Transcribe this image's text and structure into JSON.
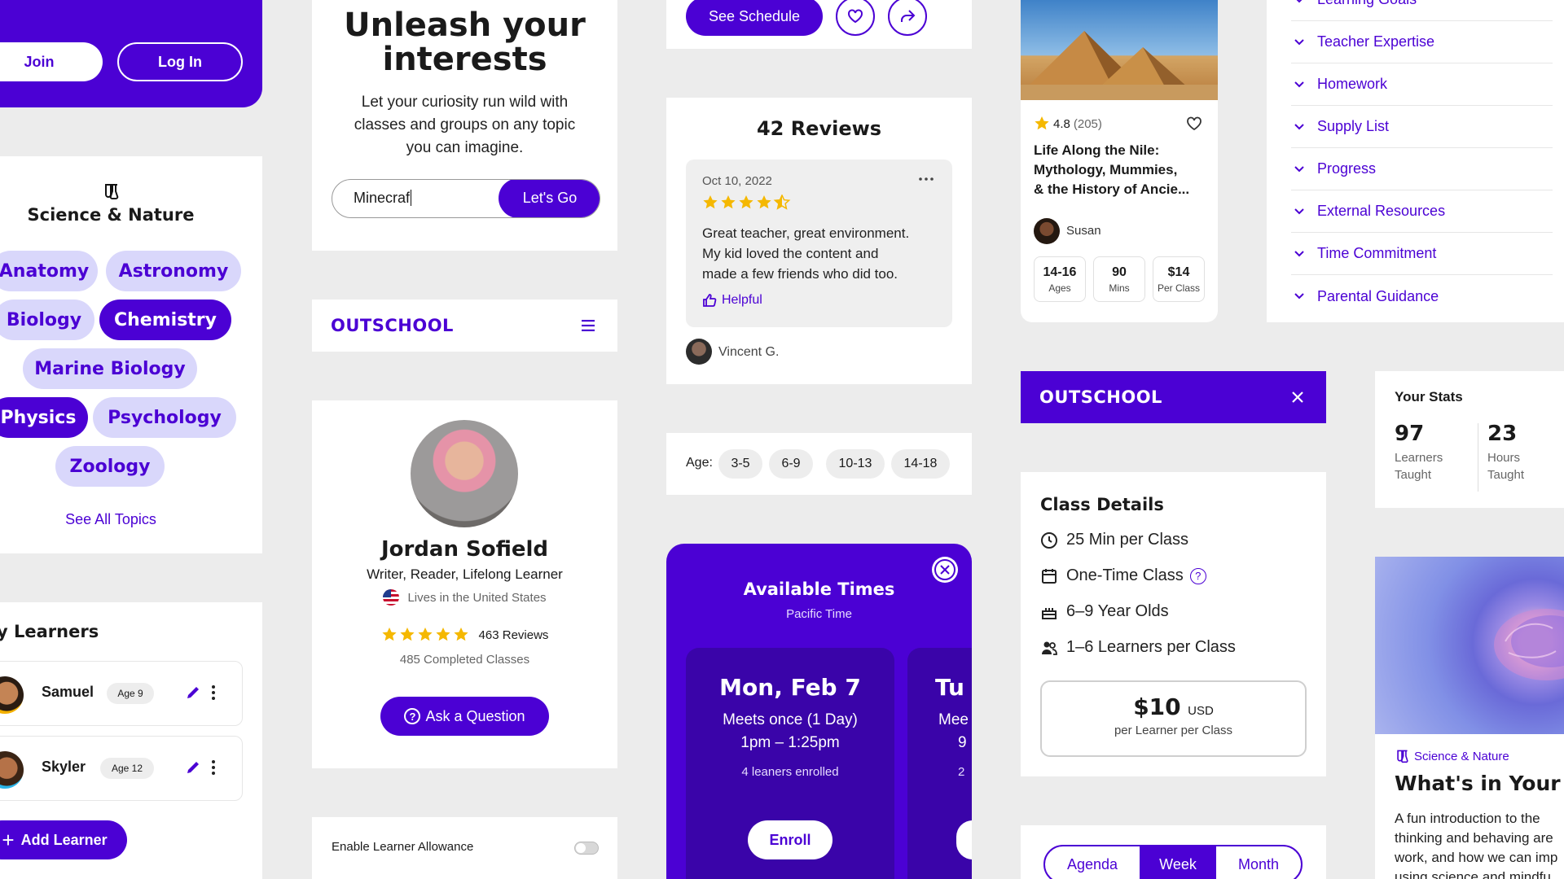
{
  "auth": {
    "join_label": "Join",
    "login_label": "Log In"
  },
  "hero": {
    "title_line1": "Unleash your",
    "title_line2": "interests",
    "subtitle_line1": "Let your curiosity run wild with",
    "subtitle_line2": "classes and groups on any topic",
    "subtitle_line3": "you can imagine.",
    "search_value": "Minecraf",
    "go_label": "Let's Go"
  },
  "topics": {
    "icon": "flask-icon",
    "title": "Science & Nature",
    "items": [
      {
        "label": "Anatomy",
        "selected": false
      },
      {
        "label": "Astronomy",
        "selected": false
      },
      {
        "label": "Biology",
        "selected": false
      },
      {
        "label": "Chemistry",
        "selected": true
      },
      {
        "label": "Marine Biology",
        "selected": false
      },
      {
        "label": "Physics",
        "selected": true
      },
      {
        "label": "Psychology",
        "selected": false
      },
      {
        "label": "Zoology",
        "selected": false
      }
    ],
    "see_all": "See All Topics"
  },
  "learners": {
    "title": "y Learners",
    "items": [
      {
        "name": "Samuel",
        "age": "Age 9"
      },
      {
        "name": "Skyler",
        "age": "Age 12"
      }
    ],
    "add_label": "Add Learner"
  },
  "brand": {
    "logo": "OUTSCHOOL"
  },
  "profile": {
    "name": "Jordan Sofield",
    "tagline": "Writer, Reader, Lifelong Learner",
    "location": "Lives in the United States",
    "reviews": "463 Reviews",
    "completed": "485 Completed Classes",
    "ask_label": "Ask a Question",
    "rating_stars": 5
  },
  "allowance": {
    "label": "Enable Learner Allowance",
    "enabled": false
  },
  "schedule": {
    "see_label": "See Schedule"
  },
  "reviews": {
    "title": "42 Reviews",
    "date": "Oct 10, 2022",
    "rating": 4.5,
    "text_line1": "Great teacher, great environment.",
    "text_line2": "My kid loved the content and",
    "text_line3": "made a few friends who did too.",
    "helpful_label": "Helpful",
    "author": "Vincent G."
  },
  "age_filter": {
    "label": "Age:",
    "options": [
      "3-5",
      "6-9",
      "10-13",
      "14-18"
    ]
  },
  "times": {
    "title": "Available Times",
    "timezone": "Pacific Time",
    "slot": {
      "day": "Mon, Feb 7",
      "meets": "Meets once (1 Day)",
      "time": "1pm – 1:25pm",
      "enrolled": "4 leaners enrolled",
      "enroll_label": "Enroll"
    },
    "next_slot": {
      "day": "Tu",
      "meets": "Mee",
      "time": "9",
      "enrolled": "2"
    }
  },
  "class_card": {
    "rating": "4.8",
    "rating_count": "(205)",
    "title_line1": "Life Along the Nile:",
    "title_line2": "Mythology, Mummies,",
    "title_line3": "& the History of Ancie...",
    "teacher": "Susan",
    "stats": [
      {
        "value": "14-16",
        "label": "Ages"
      },
      {
        "value": "90",
        "label": "Mins"
      },
      {
        "value": "$14",
        "label": "Per Class"
      }
    ]
  },
  "accordion": {
    "items": [
      "Learning Goals",
      "Teacher Expertise",
      "Homework",
      "Supply List",
      "Progress",
      "External Resources",
      "Time Commitment",
      "Parental Guidance"
    ]
  },
  "class_details": {
    "title": "Class Details",
    "rows": [
      "25 Min per Class",
      "One-Time Class",
      "6–9 Year Olds",
      "1–6 Learners per Class"
    ],
    "price": "$10",
    "currency": "USD",
    "price_sub": "per Learner per Class"
  },
  "calendar_toggle": {
    "options": [
      "Agenda",
      "Week",
      "Month"
    ],
    "active": "Week"
  },
  "stats": {
    "title": "Your Stats",
    "items": [
      {
        "value": "97",
        "label1": "Learners",
        "label2": "Taught"
      },
      {
        "value": "23",
        "label1": "Hours",
        "label2": "Taught"
      }
    ]
  },
  "feature": {
    "category": "Science & Nature",
    "title": "What's in Your I",
    "body_line1": "A fun introduction to the",
    "body_line2": "thinking and behaving are",
    "body_line3": "work, and how we can imp",
    "body_line4": "using science and mindfu"
  },
  "colors": {
    "brand": "#4b01d4",
    "tag_bg": "#d9d7fb",
    "star": "#f5b800",
    "page_bg": "#ececec"
  }
}
